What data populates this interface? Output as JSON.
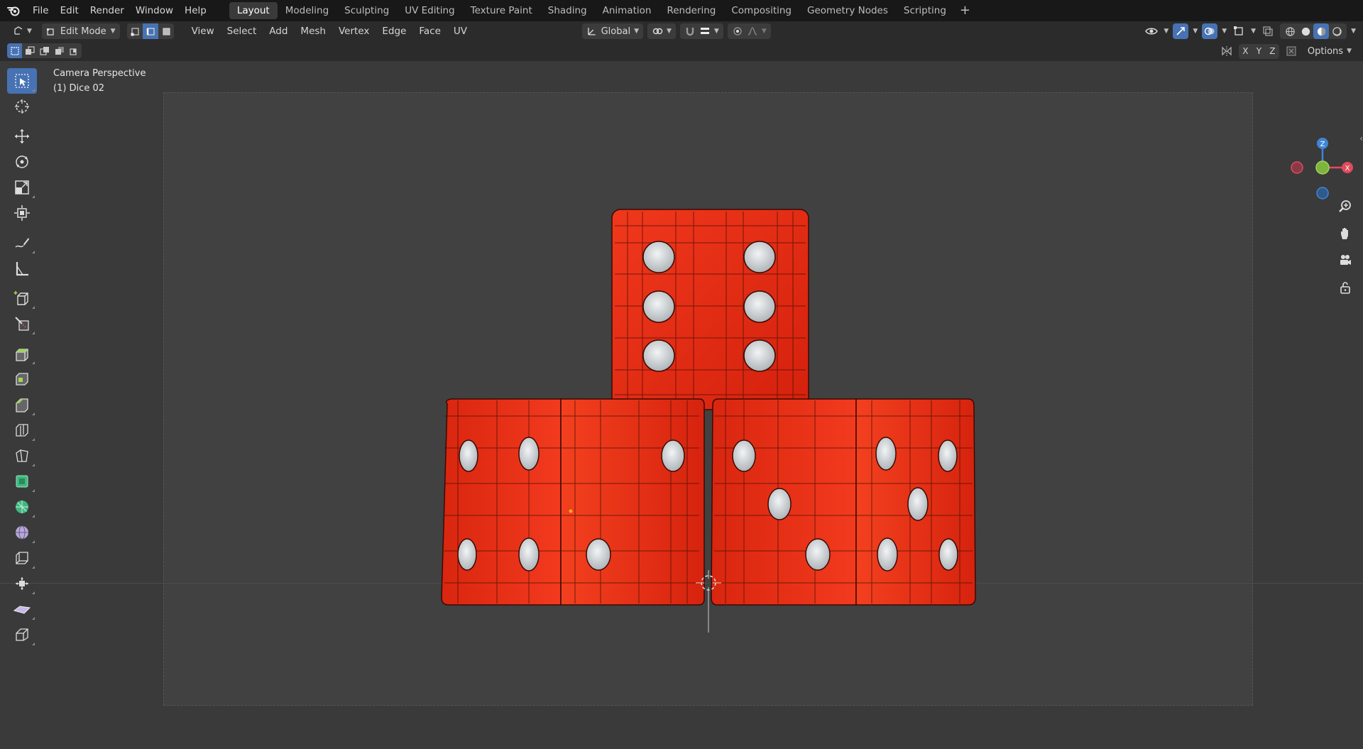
{
  "menu": [
    "File",
    "Edit",
    "Render",
    "Window",
    "Help"
  ],
  "workspaces": [
    "Layout",
    "Modeling",
    "Sculpting",
    "UV Editing",
    "Texture Paint",
    "Shading",
    "Animation",
    "Rendering",
    "Compositing",
    "Geometry Nodes",
    "Scripting"
  ],
  "workspace_add": "+",
  "header": {
    "mode": "Edit Mode",
    "menus": [
      "View",
      "Select",
      "Add",
      "Mesh",
      "Vertex",
      "Edge",
      "Face",
      "UV"
    ],
    "transform_orientation": "Global"
  },
  "subbar": {
    "axes": [
      "X",
      "Y",
      "Z"
    ],
    "options_label": "Options"
  },
  "viewport": {
    "view_name": "Camera Perspective",
    "object_info": "(1) Dice 02"
  },
  "gizmo": {
    "z": "Z",
    "x": "X"
  },
  "colors": {
    "accent": "#4772b3",
    "dice_red": "#e32b12",
    "pip": "#d9dde0",
    "axis_x": "#e04b5d",
    "axis_y": "#7fb43c",
    "axis_z": "#3f86d6"
  }
}
